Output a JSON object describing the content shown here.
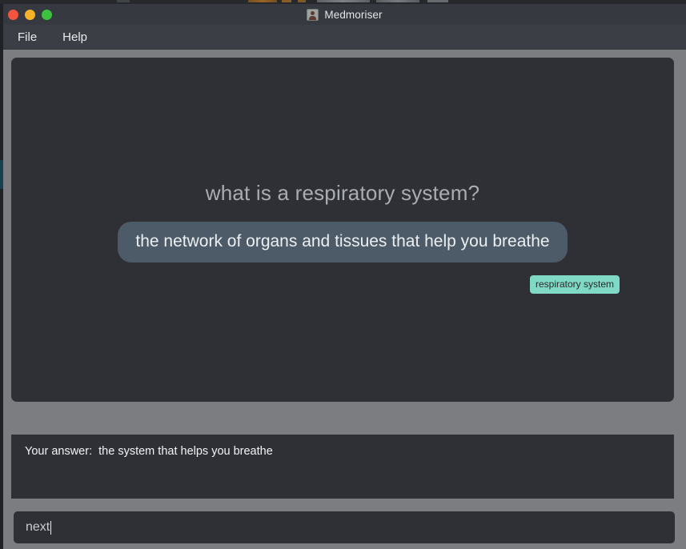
{
  "window": {
    "title": "Medmoriser",
    "title_icon": "app-avatar-icon",
    "controls": {
      "close": "close-button",
      "minimize": "minimize-button",
      "zoom": "zoom-button"
    }
  },
  "menubar": {
    "items": [
      {
        "label": "File"
      },
      {
        "label": "Help"
      }
    ]
  },
  "flashcard": {
    "question": "what is a respiratory system?",
    "answer": "the network of organs and tissues that help you breathe",
    "tag": "respiratory system"
  },
  "user_answer": {
    "label": "Your answer:",
    "value": "the system that helps you breathe",
    "full_line": "Your answer:  the system that helps you breathe"
  },
  "command_input": {
    "value": "next",
    "placeholder": ""
  },
  "colors": {
    "window_chrome": "#7b7d81",
    "titlebar": "#36393f",
    "menubar": "#3b3e45",
    "panel": "#2e3036",
    "answer_bubble": "#4c5b67",
    "tag": "#7fd9c5",
    "question_text": "#a9acb1",
    "traffic_close": "#f3533f",
    "traffic_min": "#f5b32c",
    "traffic_zoom": "#3dc23f"
  }
}
